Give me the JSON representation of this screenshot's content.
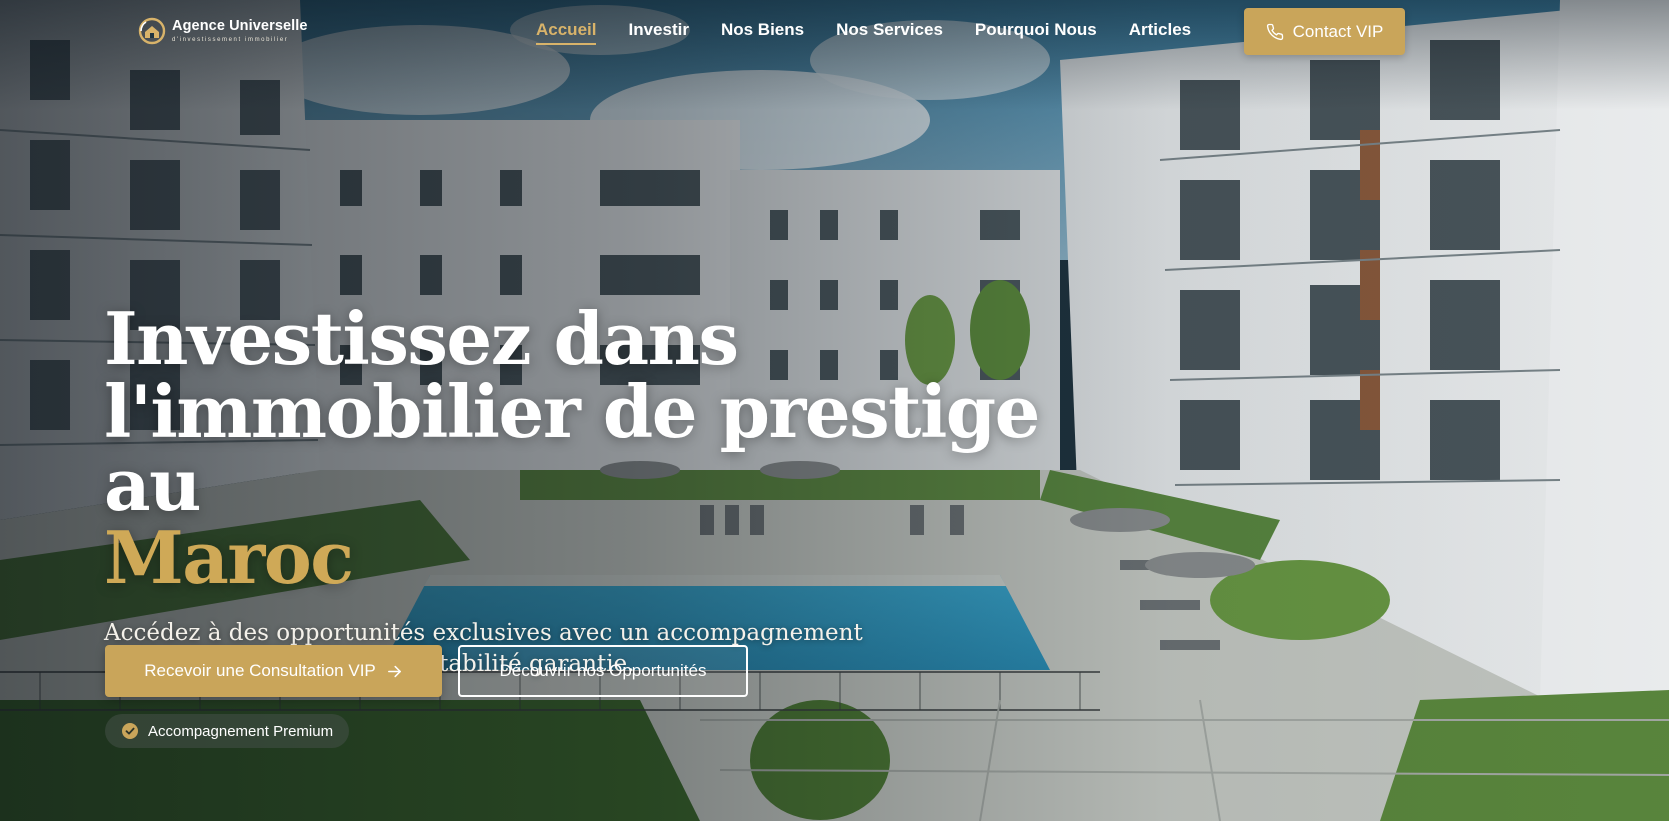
{
  "brand": {
    "name": "Agence Universelle",
    "tagline": "d'investissement immobilier",
    "logo_icon": "house-sun-logo-icon",
    "accent_color": "#c9a55a"
  },
  "nav": {
    "items": [
      {
        "label": "Accueil",
        "active": true
      },
      {
        "label": "Investir",
        "active": false
      },
      {
        "label": "Nos Biens",
        "active": false
      },
      {
        "label": "Nos Services",
        "active": false
      },
      {
        "label": "Pourquoi Nous",
        "active": false
      },
      {
        "label": "Articles",
        "active": false
      }
    ],
    "contact_button": {
      "label": "Contact VIP",
      "icon": "phone-icon"
    }
  },
  "hero": {
    "title_line1": "Investissez dans",
    "title_line2": "l'immobilier de prestige au",
    "title_accent": "Maroc",
    "subtitle": "Accédez à des opportunités exclusives avec un accompagnement 100% clé en main et une rentabilité garantie.",
    "primary_cta": {
      "label": "Recevoir une Consultation VIP",
      "icon": "arrow-right-icon"
    },
    "secondary_cta": {
      "label": "Découvrir nos Opportunités"
    },
    "badge": {
      "label": "Accompagnement Premium",
      "icon": "check-circle-icon"
    }
  }
}
